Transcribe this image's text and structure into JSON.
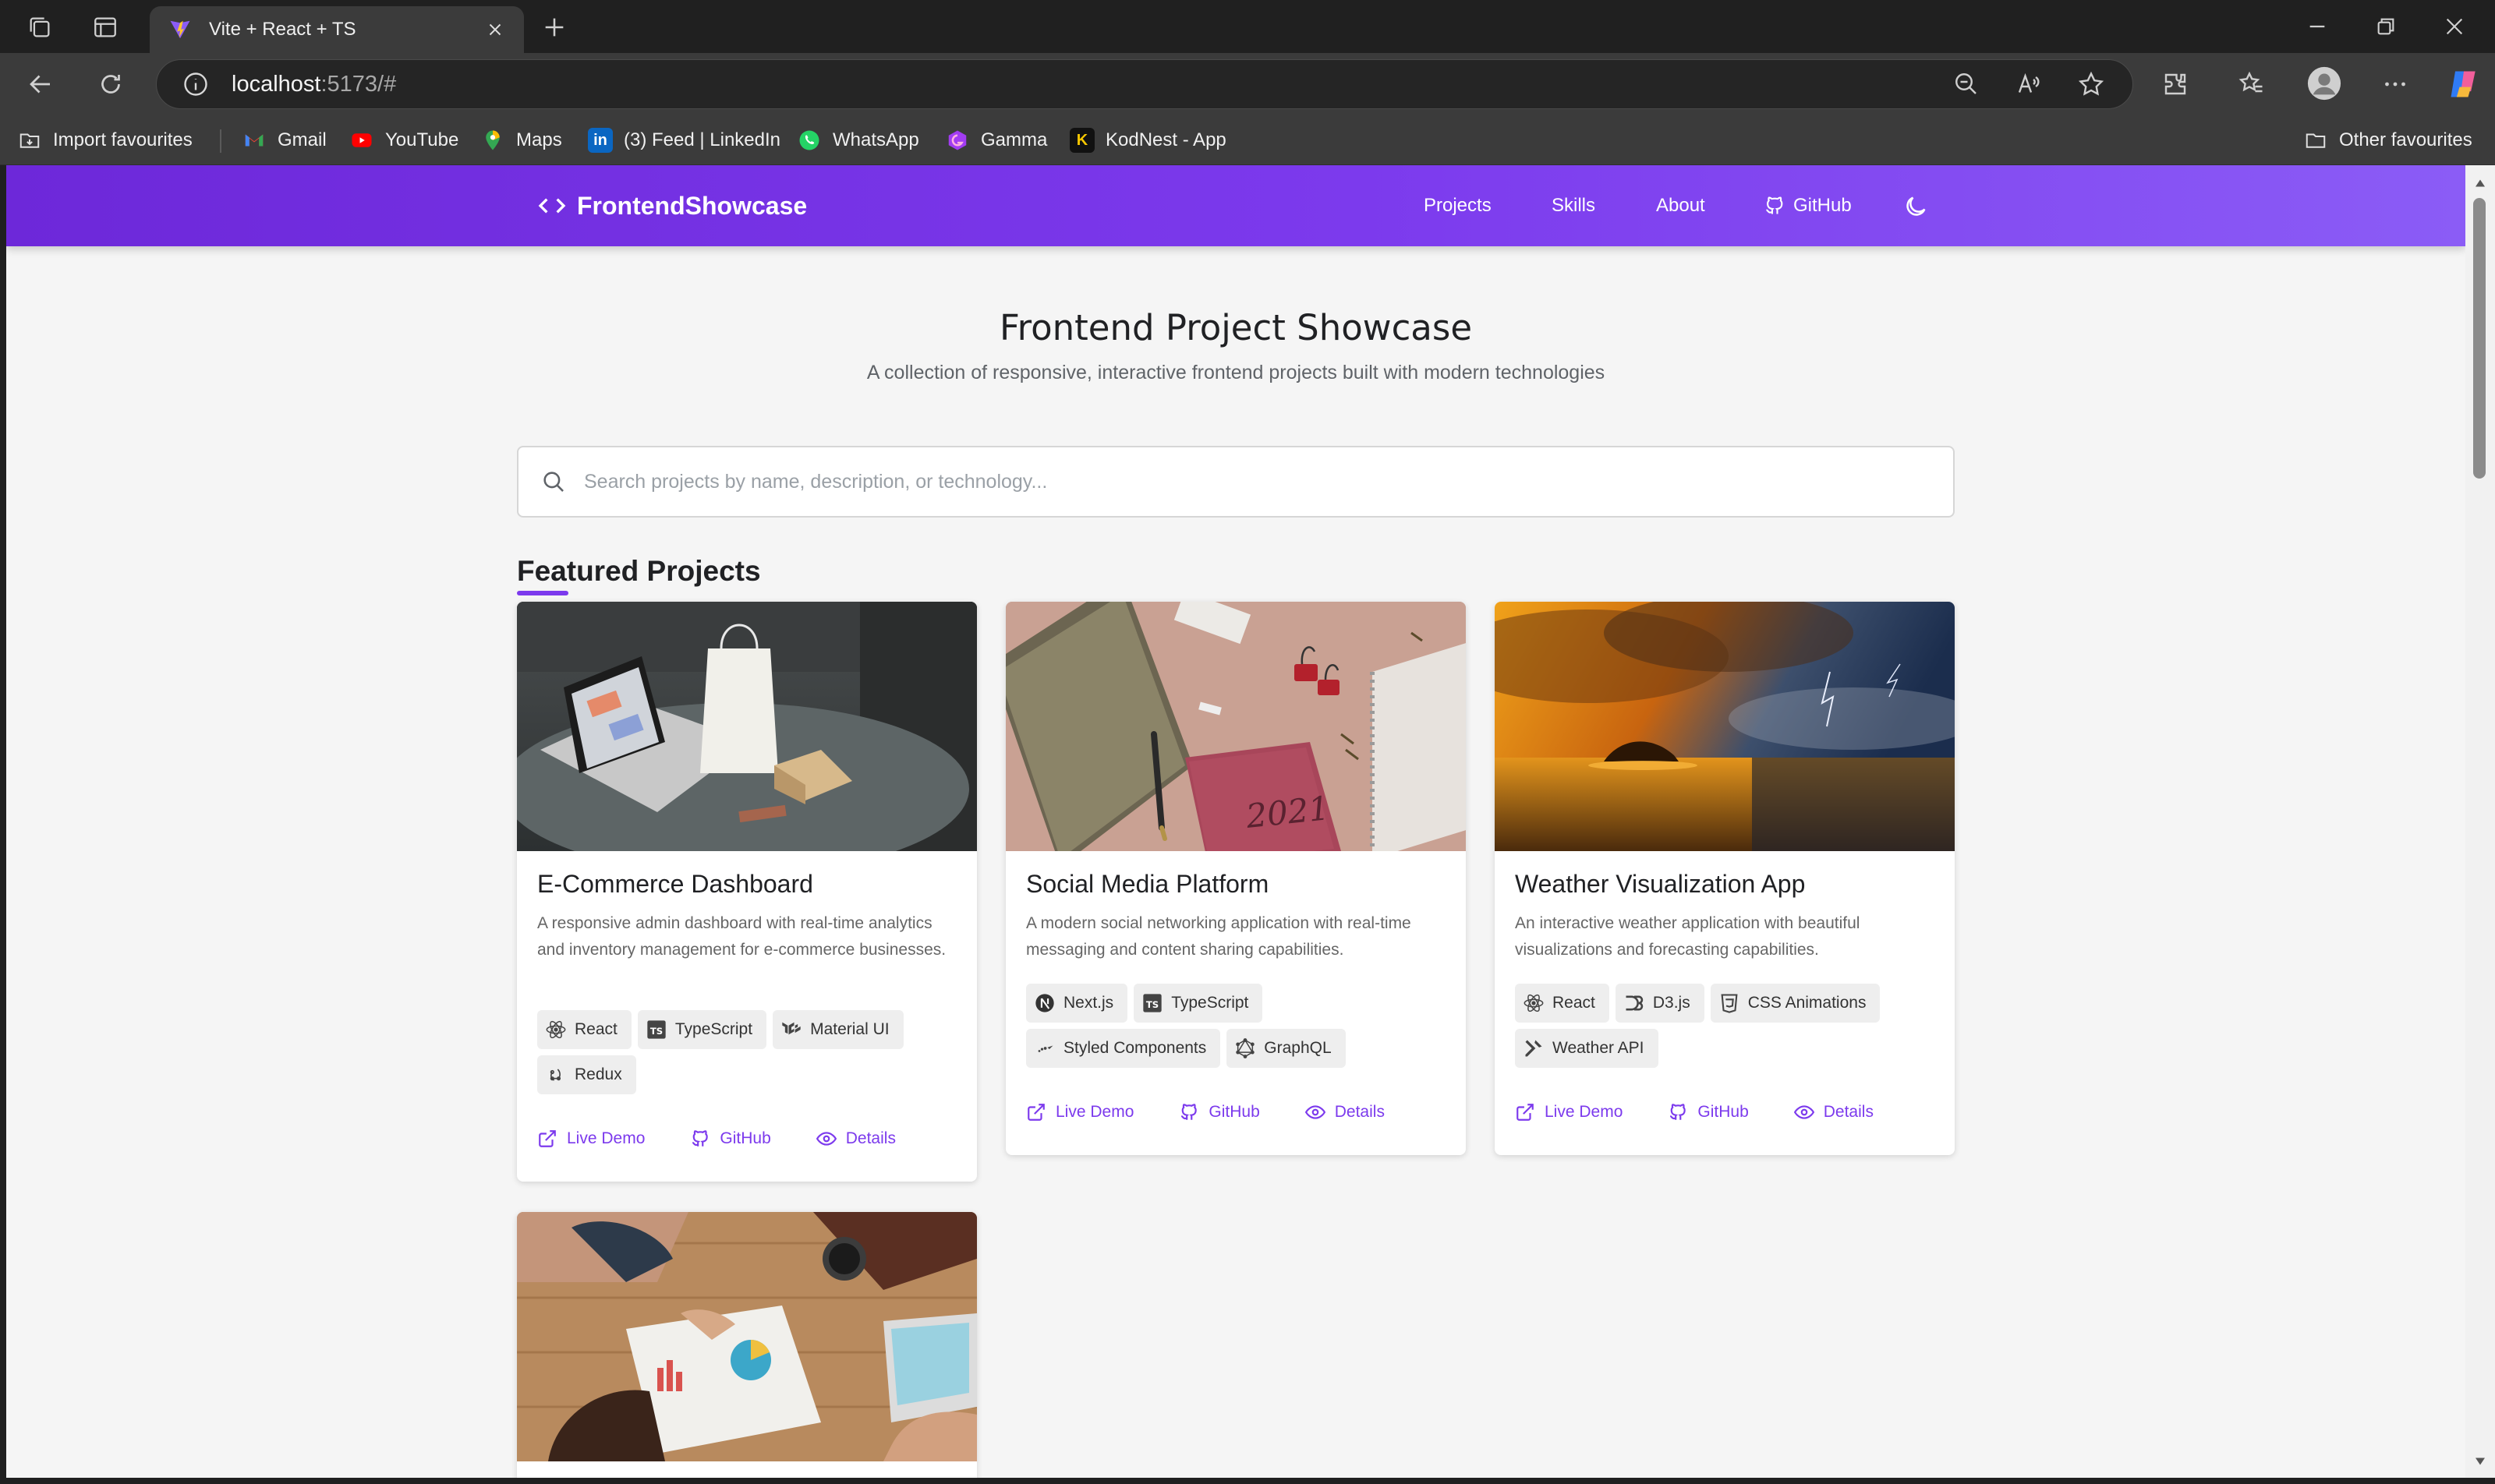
{
  "browser": {
    "tab_title": "Vite + React + TS",
    "url_host": "localhost",
    "url_rest": ":5173/#",
    "favourites": [
      {
        "label": "Import favourites",
        "icon": "import-favourites-icon"
      },
      {
        "label": "Gmail",
        "icon": "gmail-icon"
      },
      {
        "label": "YouTube",
        "icon": "youtube-icon"
      },
      {
        "label": "Maps",
        "icon": "maps-icon"
      },
      {
        "label": "(3) Feed | LinkedIn",
        "icon": "linkedin-icon"
      },
      {
        "label": "WhatsApp",
        "icon": "whatsapp-icon"
      },
      {
        "label": "Gamma",
        "icon": "gamma-icon"
      },
      {
        "label": "KodNest - App",
        "icon": "kodnest-icon"
      }
    ],
    "other_favourites": "Other favourites"
  },
  "app": {
    "brand": "FrontendShowcase",
    "nav": {
      "projects": "Projects",
      "skills": "Skills",
      "about": "About",
      "github": "GitHub"
    },
    "accent": "#7c3aed"
  },
  "hero": {
    "title": "Frontend Project Showcase",
    "subtitle": "A collection of responsive, interactive frontend projects built with modern technologies"
  },
  "search": {
    "placeholder": "Search projects by name, description, or technology..."
  },
  "featured": {
    "title": "Featured Projects",
    "projects": [
      {
        "title": "E-Commerce Dashboard",
        "description": "A responsive admin dashboard with real-time analytics and inventory management for e-commerce businesses.",
        "tags": [
          {
            "label": "React",
            "icon": "react-icon"
          },
          {
            "label": "TypeScript",
            "icon": "typescript-icon"
          },
          {
            "label": "Material UI",
            "icon": "material-ui-icon"
          },
          {
            "label": "Redux",
            "icon": "redux-icon"
          }
        ],
        "actions": {
          "demo": "Live Demo",
          "github": "GitHub",
          "details": "Details"
        }
      },
      {
        "title": "Social Media Platform",
        "description": "A modern social networking application with real-time messaging and content sharing capabilities.",
        "tags": [
          {
            "label": "Next.js",
            "icon": "nextjs-icon"
          },
          {
            "label": "TypeScript",
            "icon": "typescript-icon"
          },
          {
            "label": "Styled Components",
            "icon": "styled-components-icon"
          },
          {
            "label": "GraphQL",
            "icon": "graphql-icon"
          }
        ],
        "actions": {
          "demo": "Live Demo",
          "github": "GitHub",
          "details": "Details"
        }
      },
      {
        "title": "Weather Visualization App",
        "description": "An interactive weather application with beautiful visualizations and forecasting capabilities.",
        "tags": [
          {
            "label": "React",
            "icon": "react-icon"
          },
          {
            "label": "D3.js",
            "icon": "d3-icon"
          },
          {
            "label": "CSS Animations",
            "icon": "css-icon"
          },
          {
            "label": "Weather API",
            "icon": "tools-icon"
          }
        ],
        "actions": {
          "demo": "Live Demo",
          "github": "GitHub",
          "details": "Details"
        }
      }
    ]
  }
}
